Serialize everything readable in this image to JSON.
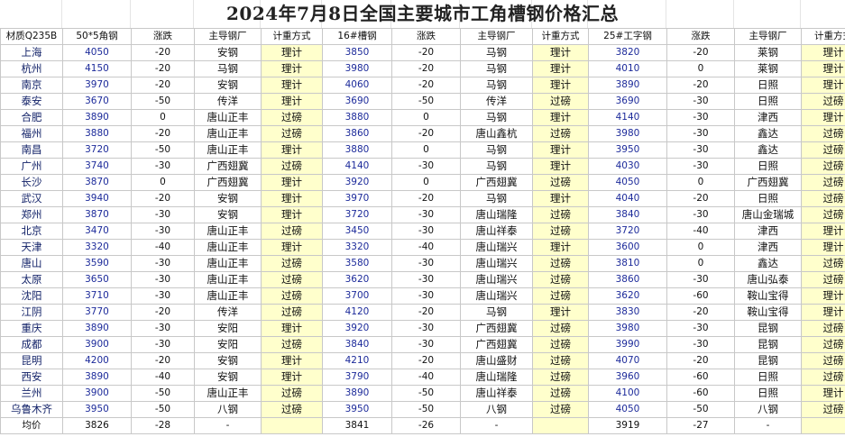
{
  "title": "2024年7月8日全国主要城市工角槽钢价格汇总",
  "headers": [
    "材质Q235B",
    "50*5角钢",
    "涨跌",
    "主导钢厂",
    "计重方式",
    "16#槽钢",
    "涨跌",
    "主导钢厂",
    "计重方式",
    "25#工字钢",
    "涨跌",
    "主导钢厂",
    "计重方式"
  ],
  "rows": [
    [
      "上海",
      "4050",
      "-20",
      "安钢",
      "理计",
      "3850",
      "-20",
      "马钢",
      "理计",
      "3820",
      "-20",
      "莱钢",
      "理计"
    ],
    [
      "杭州",
      "4150",
      "-20",
      "马钢",
      "理计",
      "3980",
      "-20",
      "马钢",
      "理计",
      "4010",
      "0",
      "莱钢",
      "理计"
    ],
    [
      "南京",
      "3970",
      "-20",
      "安钢",
      "理计",
      "4060",
      "-20",
      "马钢",
      "理计",
      "3890",
      "-20",
      "日照",
      "理计"
    ],
    [
      "泰安",
      "3670",
      "-50",
      "传洋",
      "理计",
      "3690",
      "-50",
      "传洋",
      "过磅",
      "3690",
      "-30",
      "日照",
      "过磅"
    ],
    [
      "合肥",
      "3890",
      "0",
      "唐山正丰",
      "过磅",
      "3880",
      "0",
      "马钢",
      "理计",
      "4140",
      "-30",
      "津西",
      "理计"
    ],
    [
      "福州",
      "3880",
      "-20",
      "唐山正丰",
      "过磅",
      "3860",
      "-20",
      "唐山鑫杭",
      "过磅",
      "3980",
      "-30",
      "鑫达",
      "过磅"
    ],
    [
      "南昌",
      "3720",
      "-50",
      "唐山正丰",
      "理计",
      "3880",
      "0",
      "马钢",
      "理计",
      "3950",
      "-30",
      "鑫达",
      "过磅"
    ],
    [
      "广州",
      "3740",
      "-30",
      "广西翅冀",
      "过磅",
      "4140",
      "-30",
      "马钢",
      "理计",
      "4030",
      "-30",
      "日照",
      "过磅"
    ],
    [
      "长沙",
      "3870",
      "0",
      "广西翅冀",
      "理计",
      "3920",
      "0",
      "广西翅冀",
      "过磅",
      "4050",
      "0",
      "广西翅冀",
      "过磅"
    ],
    [
      "武汉",
      "3940",
      "-20",
      "安钢",
      "理计",
      "3970",
      "-20",
      "马钢",
      "理计",
      "4040",
      "-20",
      "日照",
      "过磅"
    ],
    [
      "郑州",
      "3870",
      "-30",
      "安钢",
      "理计",
      "3720",
      "-30",
      "唐山瑞隆",
      "过磅",
      "3840",
      "-30",
      "唐山金瑞城",
      "过磅"
    ],
    [
      "北京",
      "3470",
      "-30",
      "唐山正丰",
      "过磅",
      "3450",
      "-30",
      "唐山祥泰",
      "过磅",
      "3720",
      "-40",
      "津西",
      "理计"
    ],
    [
      "天津",
      "3320",
      "-40",
      "唐山正丰",
      "理计",
      "3320",
      "-40",
      "唐山瑞兴",
      "理计",
      "3600",
      "0",
      "津西",
      "理计"
    ],
    [
      "唐山",
      "3590",
      "-30",
      "唐山正丰",
      "过磅",
      "3580",
      "-30",
      "唐山瑞兴",
      "过磅",
      "3810",
      "0",
      "鑫达",
      "过磅"
    ],
    [
      "太原",
      "3650",
      "-30",
      "唐山正丰",
      "过磅",
      "3620",
      "-30",
      "唐山瑞兴",
      "过磅",
      "3860",
      "-30",
      "唐山弘泰",
      "过磅"
    ],
    [
      "沈阳",
      "3710",
      "-30",
      "唐山正丰",
      "过磅",
      "3700",
      "-30",
      "唐山瑞兴",
      "过磅",
      "3620",
      "-60",
      "鞍山宝得",
      "理计"
    ],
    [
      "江阴",
      "3770",
      "-20",
      "传洋",
      "过磅",
      "4120",
      "-20",
      "马钢",
      "理计",
      "3830",
      "-20",
      "鞍山宝得",
      "理计"
    ],
    [
      "重庆",
      "3890",
      "-30",
      "安阳",
      "理计",
      "3920",
      "-30",
      "广西翅冀",
      "过磅",
      "3980",
      "-30",
      "昆钢",
      "过磅"
    ],
    [
      "成都",
      "3900",
      "-30",
      "安阳",
      "过磅",
      "3840",
      "-30",
      "广西翅冀",
      "过磅",
      "3990",
      "-30",
      "昆钢",
      "过磅"
    ],
    [
      "昆明",
      "4200",
      "-20",
      "安钢",
      "理计",
      "4210",
      "-20",
      "唐山盛财",
      "过磅",
      "4070",
      "-20",
      "昆钢",
      "过磅"
    ],
    [
      "西安",
      "3890",
      "-40",
      "安钢",
      "理计",
      "3790",
      "-40",
      "唐山瑞隆",
      "过磅",
      "3960",
      "-60",
      "日照",
      "过磅"
    ],
    [
      "兰州",
      "3900",
      "-50",
      "唐山正丰",
      "过磅",
      "3890",
      "-50",
      "唐山祥泰",
      "过磅",
      "4100",
      "-60",
      "日照",
      "理计"
    ],
    [
      "乌鲁木齐",
      "3950",
      "-50",
      "八钢",
      "过磅",
      "3950",
      "-50",
      "八钢",
      "过磅",
      "4050",
      "-50",
      "八钢",
      "过磅"
    ]
  ],
  "average": [
    "均价",
    "3826",
    "-28",
    "-",
    "",
    "3841",
    "-26",
    "-",
    "",
    "3919",
    "-27",
    "-",
    ""
  ]
}
